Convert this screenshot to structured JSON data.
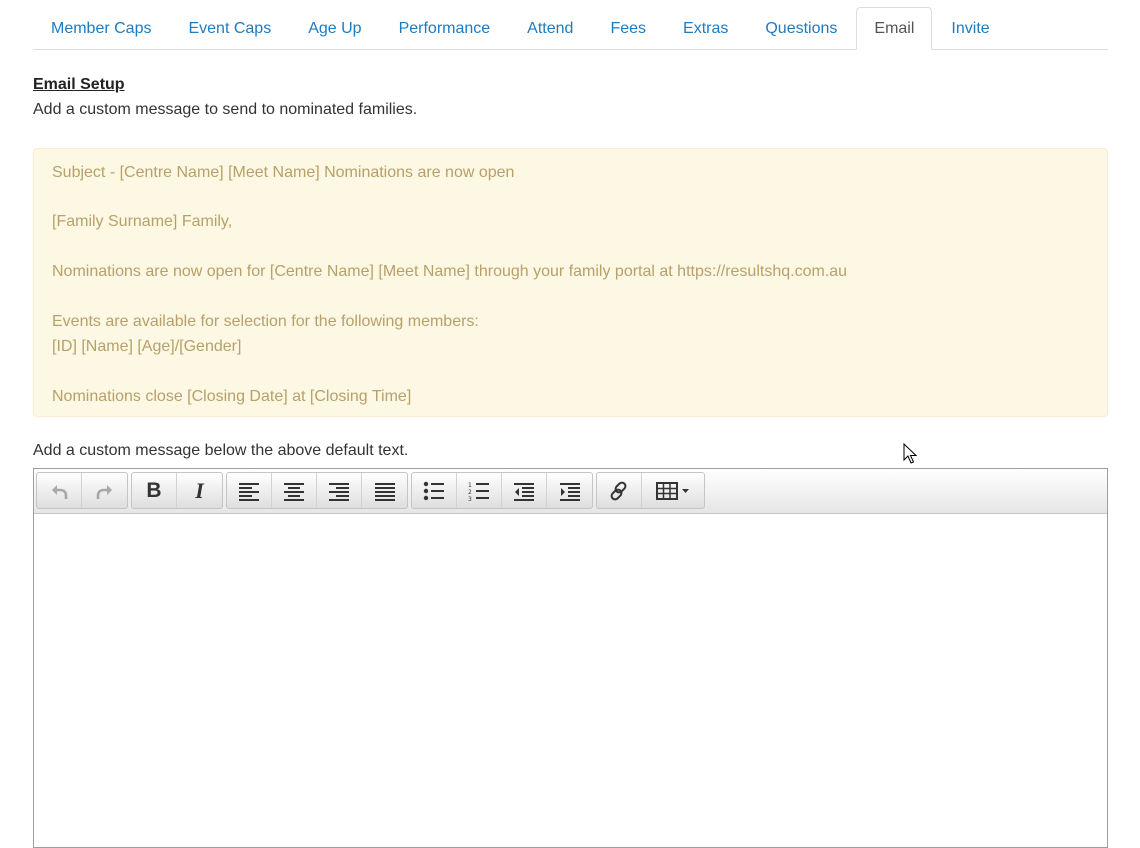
{
  "tabs": [
    {
      "label": "Member Caps",
      "active": false
    },
    {
      "label": "Event Caps",
      "active": false
    },
    {
      "label": "Age Up",
      "active": false
    },
    {
      "label": "Performance",
      "active": false
    },
    {
      "label": "Attend",
      "active": false
    },
    {
      "label": "Fees",
      "active": false
    },
    {
      "label": "Extras",
      "active": false
    },
    {
      "label": "Questions",
      "active": false
    },
    {
      "label": "Email",
      "active": true
    },
    {
      "label": "Invite",
      "active": false
    }
  ],
  "email_setup": {
    "title": "Email Setup",
    "description": "Add a custom message to send to nominated families."
  },
  "default_message": {
    "subject": "Subject - [Centre Name] [Meet Name] Nominations are now open",
    "greeting": "[Family Surname] Family,",
    "open_line": "Nominations are now open for [Centre Name] [Meet Name] through your family portal at https://resultshq.com.au",
    "events_line": "Events are available for selection for the following members:",
    "member_line": "[ID] [Name] [Age]/[Gender]",
    "close_line": "Nominations close [Closing Date] at [Closing Time]"
  },
  "custom_message": {
    "label": "Add a custom message below the above default text.",
    "value": ""
  },
  "toolbar": {
    "groups": [
      [
        "undo-icon",
        "redo-icon"
      ],
      [
        "bold-icon",
        "italic-icon"
      ],
      [
        "align-left-icon",
        "align-center-icon",
        "align-right-icon",
        "align-justify-icon"
      ],
      [
        "bullet-list-icon",
        "numbered-list-icon",
        "outdent-icon",
        "indent-icon"
      ],
      [
        "link-icon",
        "table-icon"
      ]
    ]
  },
  "colors": {
    "tab_link": "#1f7bc0",
    "alert_bg": "#fcf8e3",
    "alert_text": "#b8a06a"
  }
}
